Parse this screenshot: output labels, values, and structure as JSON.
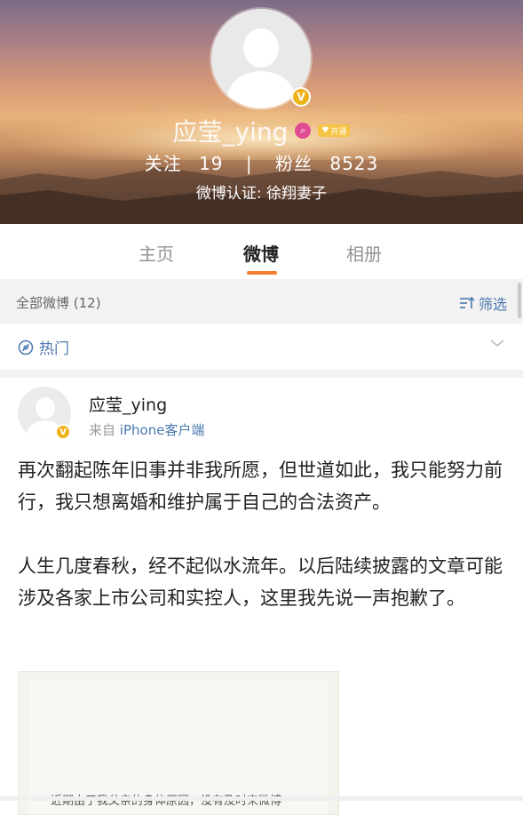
{
  "profile": {
    "username": "应莹_ying",
    "vip_badge_text": "开通",
    "following_label": "关注",
    "following_count": "19",
    "divider": "|",
    "followers_label": "粉丝",
    "followers_count": "8523",
    "verification": "微博认证: 徐翔妻子",
    "verified_badge": "V"
  },
  "tabs": [
    {
      "label": "主页",
      "active": false
    },
    {
      "label": "微博",
      "active": true
    },
    {
      "label": "相册",
      "active": false
    }
  ],
  "filter_bar": {
    "count_label": "全部微博 (12)",
    "filter_label": "筛选"
  },
  "hot": {
    "label": "热门"
  },
  "post": {
    "author": "应莹_ying",
    "source_prefix": "来自",
    "source_client": "iPhone客户端",
    "paragraph1": "再次翻起陈年旧事并非我所愿，但世道如此，我只能努力前行，我只想离婚和维护属于自己的合法资产。",
    "paragraph2": "人生几度春秋，经不起似水流年。以后陆续披露的文章可能涉及各家上市公司和实控人，这里我先说一声抱歉了。",
    "image_text": "近期由于我父亲的身体原因，没有及时来微博"
  },
  "icons": {
    "verified": "verified-v-icon",
    "search": "search-badge-icon",
    "vip": "vip-badge-icon",
    "hot": "hot-topic-icon",
    "filter": "filter-icon",
    "chevron": "chevron-down-icon"
  },
  "colors": {
    "accent": "#f57c2a",
    "link": "#4a78b0",
    "verified": "#f0b21b"
  }
}
